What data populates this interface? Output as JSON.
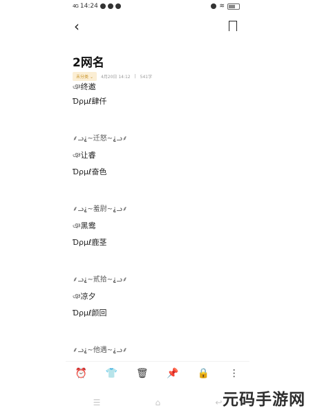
{
  "status": {
    "time": "14:24",
    "signal": "4G",
    "battery": "100"
  },
  "note": {
    "title": "2网名",
    "category": "未分类",
    "date": "4月20日 14:12",
    "count": "541字"
  },
  "lines": [
    {
      "type": "first",
      "text": "ঞ终邀"
    },
    {
      "type": "line",
      "text": "Ɗρμℓ肆仟"
    },
    {
      "type": "line",
      "text": "⸙ᓗ⸘~迁怒~⸘ᓗ⸙"
    },
    {
      "type": "line",
      "text": "ঞ让睿"
    },
    {
      "type": "line",
      "text": "Ɗρμℓ奋色"
    },
    {
      "type": "line",
      "text": "⸙ᓗ⸘~羞尉~⸘ᓗ⸙"
    },
    {
      "type": "line",
      "text": "ঞ黑鸯"
    },
    {
      "type": "line",
      "text": "Ɗρμℓ鹿茎"
    },
    {
      "type": "line",
      "text": "⸙ᓗ⸘~贰拾~⸘ᓗ⸙"
    },
    {
      "type": "line",
      "text": "ঞ凉夕"
    },
    {
      "type": "line",
      "text": "Ɗρμℓ颜回"
    },
    {
      "type": "line",
      "text": "⸙ᓗ⸘~他遇~⸘ᓗ⸙"
    }
  ],
  "toolbar": {
    "alarm": "⏰",
    "theme": "👕",
    "delete": "🗑",
    "pin": "📌",
    "lock": "🔒",
    "more": "⋮"
  },
  "nav": {
    "menu": "☰",
    "home": "⌂",
    "back": "↩"
  },
  "watermark": "元码手游网"
}
